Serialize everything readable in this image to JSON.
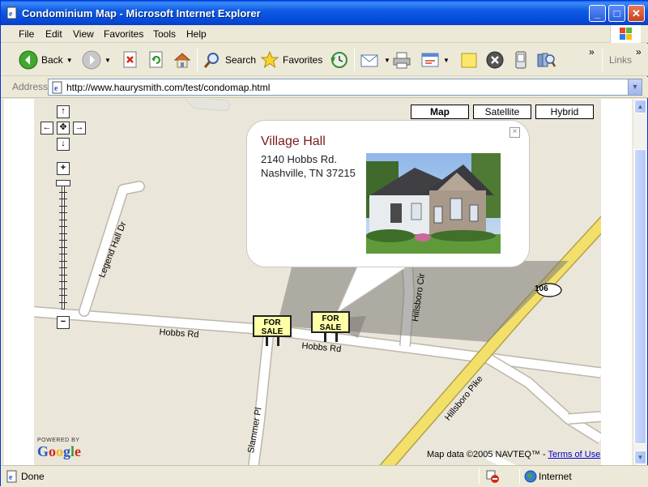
{
  "window": {
    "title": "Condominium Map - Microsoft Internet Explorer",
    "min_label": "_",
    "max_label": "□",
    "close_label": "✕"
  },
  "menu": {
    "items": [
      "File",
      "Edit",
      "View",
      "Favorites",
      "Tools",
      "Help"
    ]
  },
  "toolbar": {
    "back_label": "Back",
    "search_label": "Search",
    "favorites_label": "Favorites",
    "links_label": "Links",
    "chevron": "»"
  },
  "address": {
    "label": "Address",
    "url": "http://www.haurysmith.com/test/condomap.html"
  },
  "map": {
    "types": [
      "Map",
      "Satellite",
      "Hybrid"
    ],
    "active_type": "Map",
    "zoom_in": "+",
    "zoom_out": "−",
    "zoom_level_fraction": 0.0,
    "pan": {
      "up": "↑",
      "down": "↓",
      "left": "←",
      "right": "→",
      "center": "✥"
    },
    "roads": {
      "legend_hall": "Legend Hall Dr",
      "hobbs_left": "Hobbs Rd",
      "hobbs_right": "Hobbs Rd",
      "hillsboro_cir": "Hillsboro Cir",
      "hillsboro_pike": "Hillsboro Pike",
      "slammer": "Slammer Pl",
      "route": "106"
    },
    "pin_text_1": "FOR",
    "pin_text_2": "SALE",
    "powered_by": "POWERED BY",
    "logo_text": "Google",
    "copyright": "Map data ©2005 NAVTEQ™ - ",
    "terms": "Terms of Use"
  },
  "infowindow": {
    "title": "Village Hall",
    "address_line1": "2140 Hobbs Rd.",
    "address_line2": "Nashville, TN 37215",
    "close": "×"
  },
  "status": {
    "text": "Done",
    "zone": "Internet"
  },
  "colors": {
    "titlebar": "#0A5FE6",
    "map_bg": "#EBE6DA",
    "pike": "#F2E06A",
    "info_title": "#7A1A1A"
  }
}
